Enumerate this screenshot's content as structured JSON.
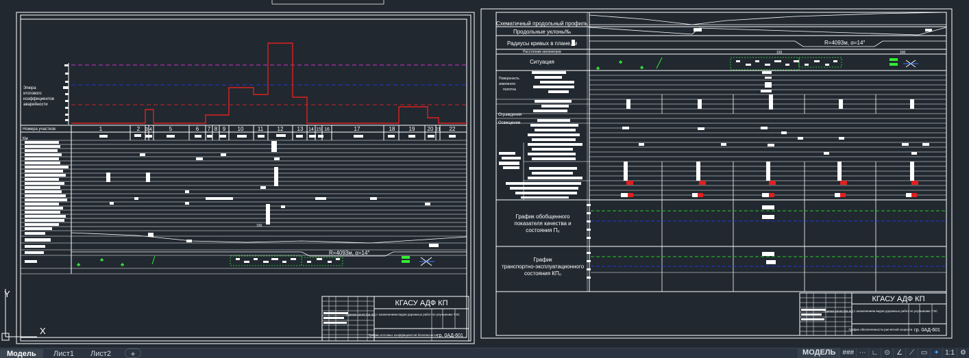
{
  "left_sheet": {
    "graph_caption_lines": [
      "Эпюра",
      "итогового",
      "коэффициентов",
      "аварийности"
    ],
    "row_header_label": "Номера участков",
    "segment_numbers": [
      "1",
      "2",
      "3",
      "4",
      "5",
      "6",
      "7",
      "8",
      "9",
      "10",
      "11",
      "12",
      "13",
      "14",
      "15",
      "16",
      "17",
      "18",
      "19",
      "20",
      "21",
      "22"
    ],
    "kilometer_label": "Км",
    "curve_text": "R=4093м, α=14°",
    "tick_150": "150",
    "title_block": {
      "org": "КГАСУ АДФ КП",
      "subject": "Оценка качества а/д с назначением видов дорожных работ по улучшению ТЭС",
      "sheet_title": "График итоговых коэффициентов безопасности",
      "group": "гр. 0АД-601"
    }
  },
  "right_sheet": {
    "rows": [
      "Схематичный продольный профиль",
      "Продольные уклоны‰",
      "Радиусы кривых в плане, м",
      "Расстояние километров",
      "Ситуация"
    ],
    "surface_label_lines": [
      "Поверхность",
      "земляного",
      "полотна"
    ],
    "fencing_label": "Ограждения",
    "lighting_label": "Освещение",
    "graph1_lines": [
      "График обобщенного",
      "показателя качества и",
      "состояния П₀"
    ],
    "graph2_lines": [
      "График",
      "транспортно-эксплуатационного",
      "состояния КП₀"
    ],
    "curve_text": "R=4093м, α=14°",
    "tick_150": "150",
    "tick_200": "200",
    "title_block": {
      "org": "КГАСУ АДФ КП",
      "subject": "Оценка качества а/д с назначением видов дорожных работ по улучшению ТЭС",
      "sheet_title": "График обеспеченности расчетной скорости",
      "group": "гр. 0АД-601"
    }
  },
  "ucs": {
    "y_label": "Y",
    "x_label": "X"
  },
  "tabs": [
    "Модель",
    "Лист1",
    "Лист2"
  ],
  "tab_add_symbol": "+",
  "status": {
    "model_label": "МОДЕЛЬ",
    "grid_symbol": "###",
    "snap_symbol": "⋯",
    "ortho_symbol": "∟",
    "polar_symbol": "⊙",
    "osnap_symbol": "∠",
    "track_symbol": "⟋",
    "lwt_symbol": "▭",
    "anno_symbol": "✦",
    "scale_label": "1:1",
    "gear_symbol": "⚙"
  },
  "colors": {
    "background": "#212830",
    "line": "#ffffff",
    "graph_red": "#e02020",
    "dash_magenta": "#cc33cc",
    "dash_blue": "#2233dd",
    "dash_red": "#cc2222",
    "dash_green": "#22cc22",
    "vegetation_green": "#33ee33"
  }
}
